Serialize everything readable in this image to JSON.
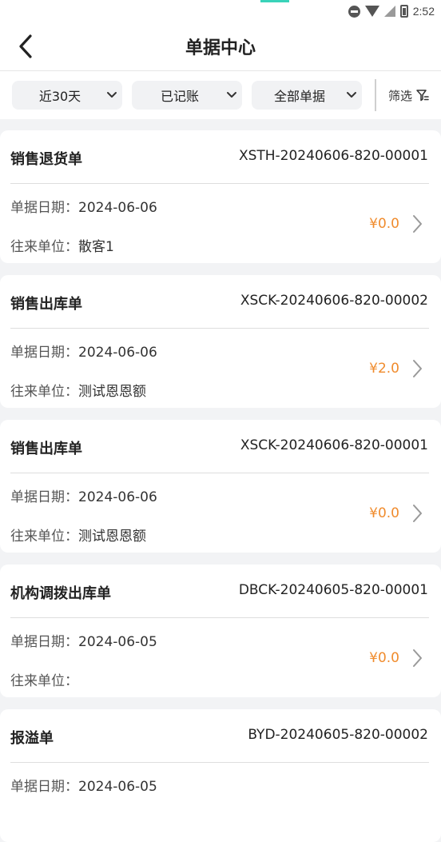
{
  "status_bar": {
    "time": "2:52",
    "icons": [
      "do-not-disturb-icon",
      "wifi-icon",
      "cell-signal-icon",
      "battery-icon"
    ]
  },
  "header": {
    "title": "单据中心",
    "back_icon": "chevron-left-icon"
  },
  "filters": {
    "period": "近30天",
    "status": "已记账",
    "doc_type": "全部单据",
    "filter_label": "筛选",
    "filter_icon": "funnel-icon"
  },
  "labels": {
    "date_prefix": "单据日期：",
    "partner_prefix": "往来单位："
  },
  "colors": {
    "amount": "#f08c2e",
    "accent": "#39d3b9"
  },
  "documents": [
    {
      "type": "销售退货单",
      "number": "XSTH-20240606-820-00001",
      "date": "2024-06-06",
      "partner": "散客1",
      "amount": "¥0.0"
    },
    {
      "type": "销售出库单",
      "number": "XSCK-20240606-820-00002",
      "date": "2024-06-06",
      "partner": "测试恩恩额",
      "amount": "¥2.0"
    },
    {
      "type": "销售出库单",
      "number": "XSCK-20240606-820-00001",
      "date": "2024-06-06",
      "partner": "测试恩恩额",
      "amount": "¥0.0"
    },
    {
      "type": "机构调拨出库单",
      "number": "DBCK-20240605-820-00001",
      "date": "2024-06-05",
      "partner": "",
      "amount": "¥0.0"
    },
    {
      "type": "报溢单",
      "number": "BYD-20240605-820-00002",
      "date": "2024-06-05",
      "partner": "",
      "amount": ""
    }
  ]
}
